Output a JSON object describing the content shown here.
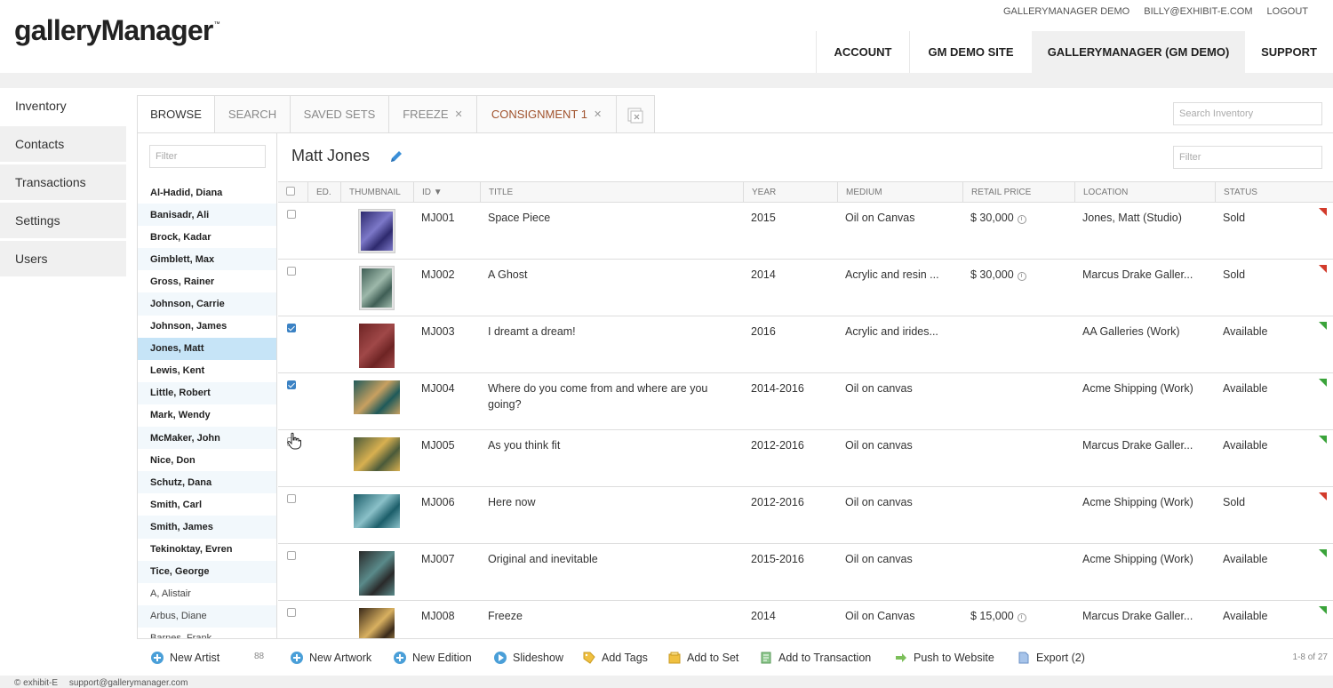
{
  "app": {
    "logo": "galleryManager",
    "logo_mark": "™"
  },
  "top_links": [
    "GALLERYMANAGER DEMO",
    "BILLY@EXHIBIT-E.COM",
    "LOGOUT"
  ],
  "main_nav": [
    {
      "label": "ACCOUNT",
      "active": false
    },
    {
      "label": "GM DEMO SITE",
      "active": false
    },
    {
      "label": "GALLERYMANAGER (GM DEMO)",
      "active": true
    },
    {
      "label": "SUPPORT",
      "active": false
    }
  ],
  "sidebar": {
    "items": [
      "Inventory",
      "Contacts",
      "Transactions",
      "Settings",
      "Users"
    ],
    "active": "Inventory"
  },
  "tabs": [
    {
      "label": "BROWSE",
      "active": true,
      "closable": false
    },
    {
      "label": "SEARCH",
      "active": false,
      "closable": false
    },
    {
      "label": "SAVED SETS",
      "active": false,
      "closable": false
    },
    {
      "label": "FREEZE",
      "active": false,
      "closable": true
    },
    {
      "label": "CONSIGNMENT 1",
      "active": false,
      "closable": true
    }
  ],
  "search_inventory_placeholder": "Search Inventory",
  "artist_filter_placeholder": "Filter",
  "main_filter_placeholder": "Filter",
  "artists": [
    {
      "name": "Al-Hadid, Diana",
      "bold": true
    },
    {
      "name": "Banisadr, Ali",
      "bold": true
    },
    {
      "name": "Brock, Kadar",
      "bold": true
    },
    {
      "name": "Gimblett, Max",
      "bold": true
    },
    {
      "name": "Gross, Rainer",
      "bold": true
    },
    {
      "name": "Johnson, Carrie",
      "bold": true
    },
    {
      "name": "Johnson, James",
      "bold": true
    },
    {
      "name": "Jones, Matt",
      "bold": true,
      "selected": true
    },
    {
      "name": "Lewis, Kent",
      "bold": true
    },
    {
      "name": "Little, Robert",
      "bold": true
    },
    {
      "name": "Mark, Wendy",
      "bold": true
    },
    {
      "name": "McMaker, John",
      "bold": true
    },
    {
      "name": "Nice, Don",
      "bold": true
    },
    {
      "name": "Schutz, Dana",
      "bold": true
    },
    {
      "name": "Smith, Carl",
      "bold": true
    },
    {
      "name": "Smith, James",
      "bold": true
    },
    {
      "name": "Tekinoktay, Evren",
      "bold": true
    },
    {
      "name": "Tice, George",
      "bold": true
    },
    {
      "name": "A, Alistair",
      "bold": false
    },
    {
      "name": "Arbus, Diane",
      "bold": false
    },
    {
      "name": "Barnes, Frank",
      "bold": false
    }
  ],
  "selected_artist": "Matt Jones",
  "columns": [
    "",
    "ED.",
    "THUMBNAIL",
    "ID ▼",
    "TITLE",
    "YEAR",
    "MEDIUM",
    "RETAIL PRICE",
    "LOCATION",
    "STATUS"
  ],
  "rows": [
    {
      "checked": false,
      "id": "MJ001",
      "title": "Space Piece",
      "year": "2015",
      "medium": "Oil on Canvas",
      "price": "$ 30,000",
      "location": "Jones, Matt (Studio)",
      "status": "Sold",
      "flag": "#d23a2a",
      "thumb": {
        "bg": "#2e2a6e",
        "accent": "#7c78c8",
        "w": 40,
        "h": 48,
        "frame": true
      }
    },
    {
      "checked": false,
      "id": "MJ002",
      "title": "A Ghost",
      "year": "2014",
      "medium": "Acrylic and resin ...",
      "price": "$ 30,000",
      "location": "Marcus Drake Galler...",
      "status": "Sold",
      "flag": "#d23a2a",
      "thumb": {
        "bg": "#3f5e55",
        "accent": "#9db8aa",
        "w": 38,
        "h": 48,
        "frame": true
      }
    },
    {
      "checked": true,
      "id": "MJ003",
      "title": "I dreamt a dream!",
      "year": "2016",
      "medium": "Acrylic and irides...",
      "price": "",
      "location": "AA Galleries (Work)",
      "status": "Available",
      "flag": "#3aa33a",
      "thumb": {
        "bg": "#6e2424",
        "accent": "#a04848",
        "w": 40,
        "h": 50,
        "frame": false
      }
    },
    {
      "checked": true,
      "id": "MJ004",
      "title": "Where do you come from and where are you going?",
      "year": "2014-2016",
      "medium": "Oil on canvas",
      "price": "",
      "location": "Acme Shipping (Work)",
      "status": "Available",
      "flag": "#3aa33a",
      "thumb": {
        "bg": "#1f5a5a",
        "accent": "#c8a060",
        "w": 52,
        "h": 38,
        "frame": false
      }
    },
    {
      "checked": false,
      "id": "MJ005",
      "title": "As you think fit",
      "year": "2012-2016",
      "medium": "Oil on canvas",
      "price": "",
      "location": "Marcus Drake Galler...",
      "status": "Available",
      "flag": "#3aa33a",
      "thumb": {
        "bg": "#4a5a3a",
        "accent": "#d8b050",
        "w": 52,
        "h": 38,
        "frame": false
      }
    },
    {
      "checked": false,
      "id": "MJ006",
      "title": "Here now",
      "year": "2012-2016",
      "medium": "Oil on canvas",
      "price": "",
      "location": "Acme Shipping (Work)",
      "status": "Sold",
      "flag": "#d23a2a",
      "thumb": {
        "bg": "#1c5e6a",
        "accent": "#8ac0c8",
        "w": 52,
        "h": 38,
        "frame": false
      }
    },
    {
      "checked": false,
      "id": "MJ007",
      "title": "Original and inevitable",
      "year": "2015-2016",
      "medium": "Oil on canvas",
      "price": "",
      "location": "Acme Shipping (Work)",
      "status": "Available",
      "flag": "#3aa33a",
      "thumb": {
        "bg": "#2a2a2a",
        "accent": "#5a8a8a",
        "w": 40,
        "h": 50,
        "frame": false
      }
    },
    {
      "checked": false,
      "id": "MJ008",
      "title": "Freeze",
      "year": "2014",
      "medium": "Oil on Canvas",
      "price": "$ 15,000",
      "location": "Marcus Drake Galler...",
      "status": "Available",
      "flag": "#3aa33a",
      "thumb": {
        "bg": "#3a2a1a",
        "accent": "#d8b060",
        "w": 40,
        "h": 48,
        "frame": false
      }
    }
  ],
  "footer": {
    "new_artist": "New Artist",
    "artist_count": "88",
    "actions": [
      "New Artwork",
      "New Edition",
      "Slideshow",
      "Add Tags",
      "Add to Set",
      "Add to Transaction",
      "Push to Website",
      "Export (2)"
    ],
    "paging": "1-8 of 27"
  },
  "status_bar": [
    "© exhibit-E",
    "support@gallerymanager.com"
  ]
}
